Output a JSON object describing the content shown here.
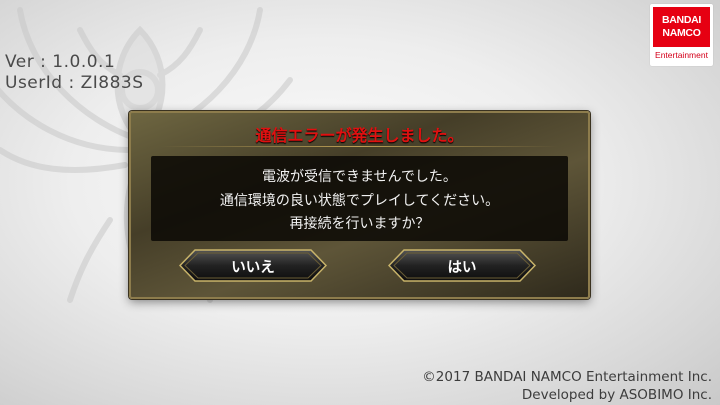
{
  "info": {
    "version_label": "Ver : 1.0.0.1",
    "user_label": "UserId : ZI883S"
  },
  "publisher_logo": {
    "name": "BANDAI NAMCO",
    "line1": "BANDAI",
    "line2": "NAMCO",
    "subtitle": "Entertainment",
    "color": "#e60012"
  },
  "dialog": {
    "title": "通信エラーが発生しました。",
    "message_lines": [
      "電波が受信できませんでした。",
      "通信環境の良い状態でプレイしてください。",
      "再接続を行いますか？"
    ],
    "no_button": "いいえ",
    "yes_button": "はい",
    "title_color": "#e01010",
    "accent_color": "#c9b46a"
  },
  "footer": {
    "copyright": "©2017 BANDAI NAMCO Entertainment Inc.",
    "developer": "Developed by ASOBIMO Inc."
  },
  "background": {
    "icon": "winged-crest-emblem"
  }
}
